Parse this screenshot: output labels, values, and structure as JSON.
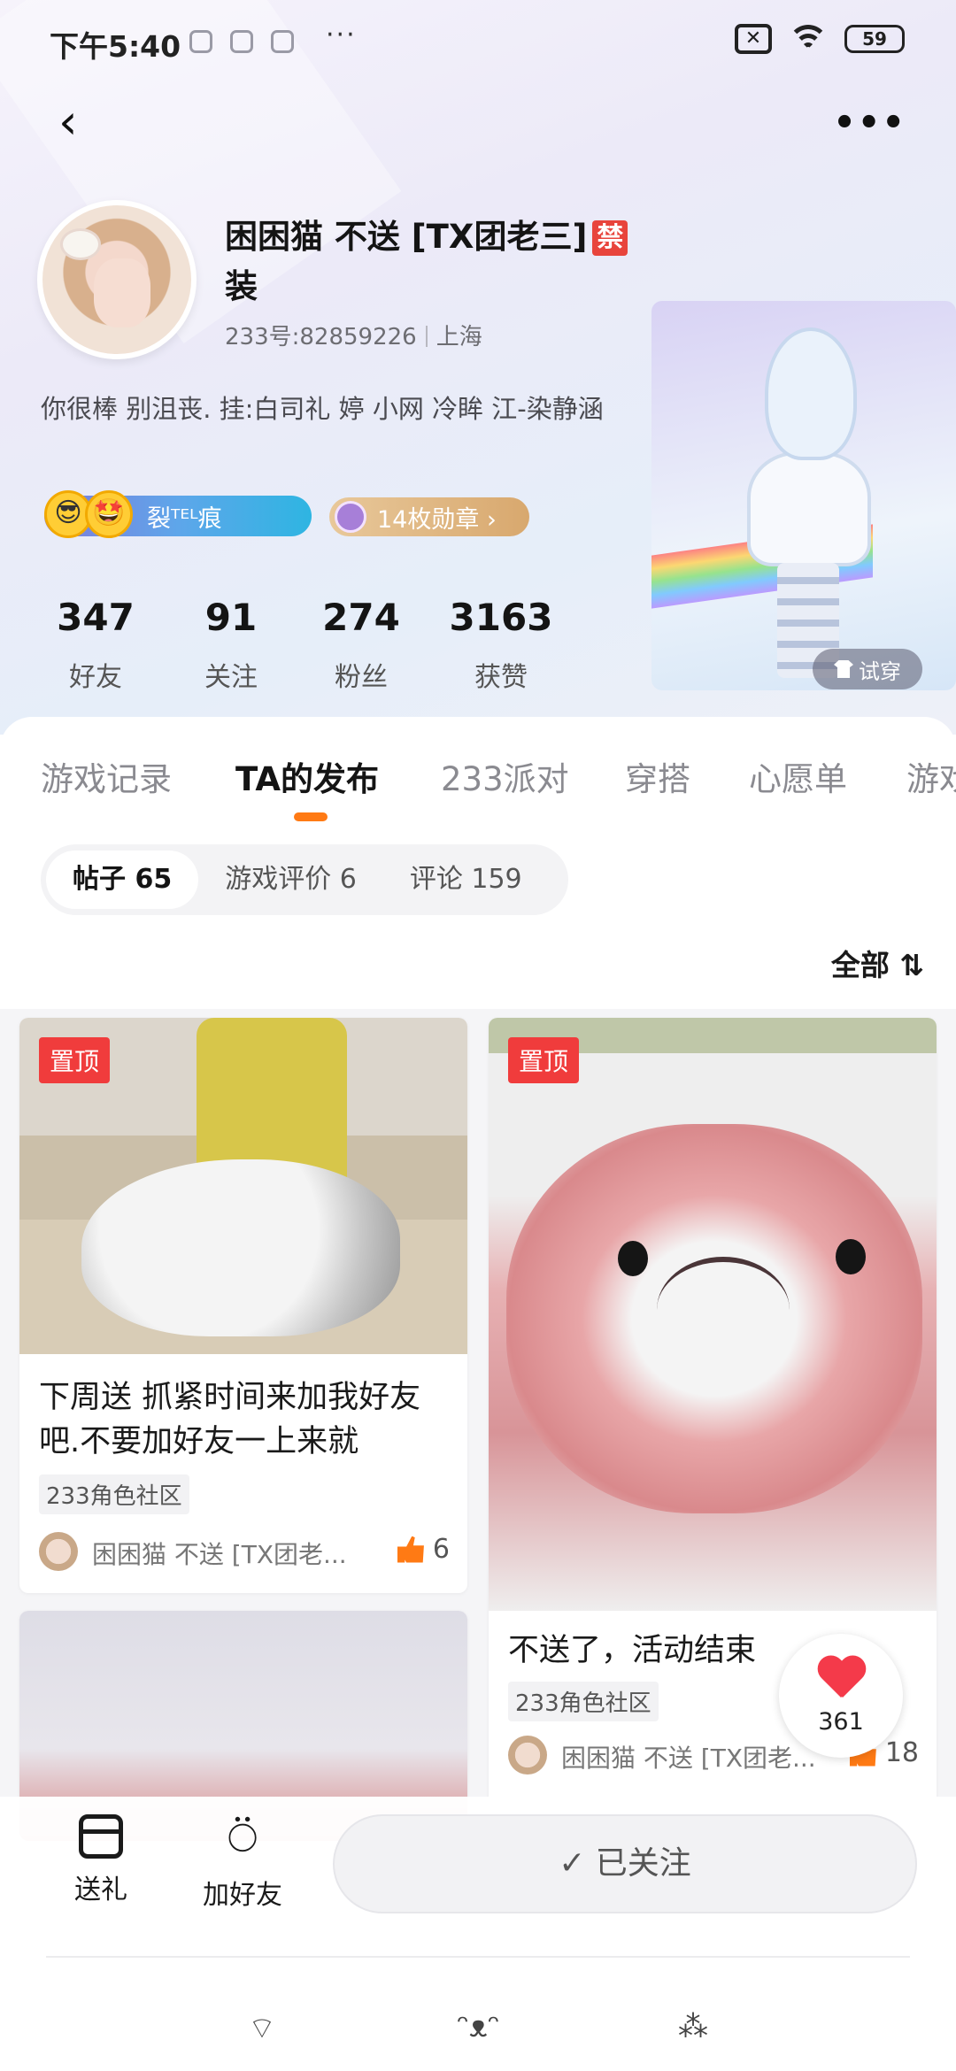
{
  "status": {
    "time": "下午5:40",
    "more": "···",
    "sim": "✕",
    "battery": "59"
  },
  "header": {
    "back": "‹",
    "more": "•••"
  },
  "profile": {
    "name": "困困猫 不送 [TX团老三]",
    "ban_badge": "禁",
    "name_line2": "装",
    "uid": "233号:82859226",
    "location": "上海",
    "bio": "你很棒 别沮丧. 挂:白司礼 婷 小网 冷眸 江-染静涵",
    "badge_text": "裂ᵀᴱᴸ痕",
    "medals": "14枚勋章 ›",
    "try_on": "试穿"
  },
  "stats": [
    {
      "value": "347",
      "label": "好友"
    },
    {
      "value": "91",
      "label": "关注"
    },
    {
      "value": "274",
      "label": "粉丝"
    },
    {
      "value": "3163",
      "label": "获赞"
    }
  ],
  "tabs": [
    "游戏记录",
    "TA的发布",
    "233派对",
    "穿搭",
    "心愿单",
    "游戏"
  ],
  "active_tab": "TA的发布",
  "subtabs": [
    "帖子 65",
    "游戏评价 6",
    "评论 159"
  ],
  "sort": "全部 ⇅",
  "posts": [
    {
      "pin": "置顶",
      "title": "下周送 抓紧时间来加我好友吧.不要加好友一上来就",
      "tag": "233角色社区",
      "author": "困困猫 不送 [TX团老...",
      "likes": "6"
    },
    {
      "pin": "置顶",
      "title": "不送了，活动结束",
      "tag": "233角色社区",
      "author": "困困猫 不送 [TX团老...",
      "likes": "18"
    }
  ],
  "heart_count": "361",
  "bottom": {
    "gift": "送礼",
    "add_friend": "加好友",
    "follow": "✓ 已关注"
  },
  "nav": [
    "⌔",
    "ᵔᴥᵔ",
    "⁂"
  ]
}
